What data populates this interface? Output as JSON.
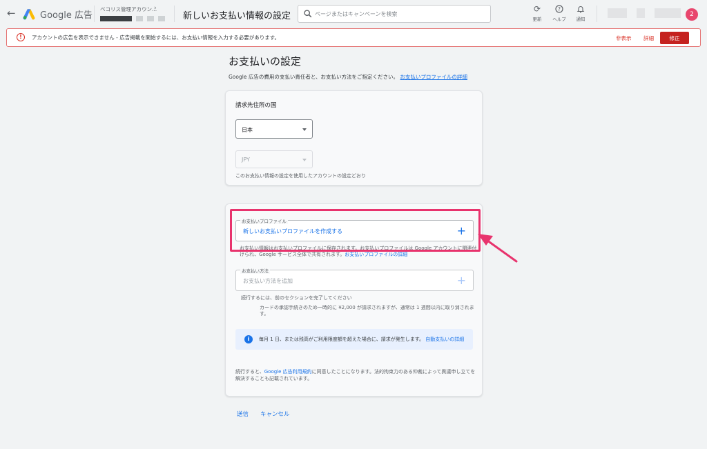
{
  "header": {
    "brand": "Google 広告",
    "account_name": "ベコリス管理アカウン...",
    "page_heading": "新しいお支払い情報の設定",
    "search_placeholder": "ページまたはキャンペーンを検索",
    "tools": [
      {
        "icon": "refresh-icon",
        "label": "更新"
      },
      {
        "icon": "help-icon",
        "label": "ヘルプ"
      },
      {
        "icon": "bell-icon",
        "label": "通知"
      }
    ],
    "avatar_badge": "2"
  },
  "alert": {
    "text": "アカウントの広告を表示できません - 広告掲載を開始するには、お支払い情報を入力する必要があります。",
    "dismiss": "非表示",
    "details": "詳細",
    "fix": "修正"
  },
  "main": {
    "title": "お支払いの設定",
    "intro_text": "Google 広告の費用の支払い責任者と、お支払い方法をご指定ください。",
    "intro_link": "お支払いプロファイルの詳細"
  },
  "billing_country": {
    "label": "請求先住所の国",
    "country": "日本",
    "currency": "JPY",
    "note": "このお支払い情報の設定を使用したアカウントの設定どおり"
  },
  "payment_profile": {
    "legend": "お支払いプロファイル",
    "create": "新しいお支払いプロファイルを作成する",
    "note_prefix": "お支払い情報はお支払いプロファイルに保存されます。お支払いプロファイルは Google アカウントに関連付",
    "note_suffix": "けられ、Google サービス全体で共有されます。",
    "note_link": "お支払いプロファイルの詳細"
  },
  "payment_method": {
    "legend": "お支払い方法",
    "placeholder": "お支払い方法を追加",
    "prereq": "続行するには、前のセクションを完了してください",
    "card_note_1": "カードの承認手続きのため一時的に ¥2,000 が請求されますが、通常は 1 週間以内に取り消されま",
    "card_note_2": "す。"
  },
  "info": {
    "text": "毎月 1 日、または残高がご利用限度額を超えた場合に、請求が発生します。",
    "link": "自動支払いの詳細"
  },
  "terms": {
    "line1_prefix": "続行すると、",
    "line1_link": "Google 広告利用規約",
    "line1_suffix": "に同意したことになります。法的拘束力のある仲裁によって異議申し立てを",
    "line2": "解決することも記載されています。"
  },
  "footer": {
    "submit": "送信",
    "cancel": "キャンセル"
  },
  "colors": {
    "accent": "#1a73e8",
    "error": "#d93025",
    "highlight": "#e8336d"
  }
}
